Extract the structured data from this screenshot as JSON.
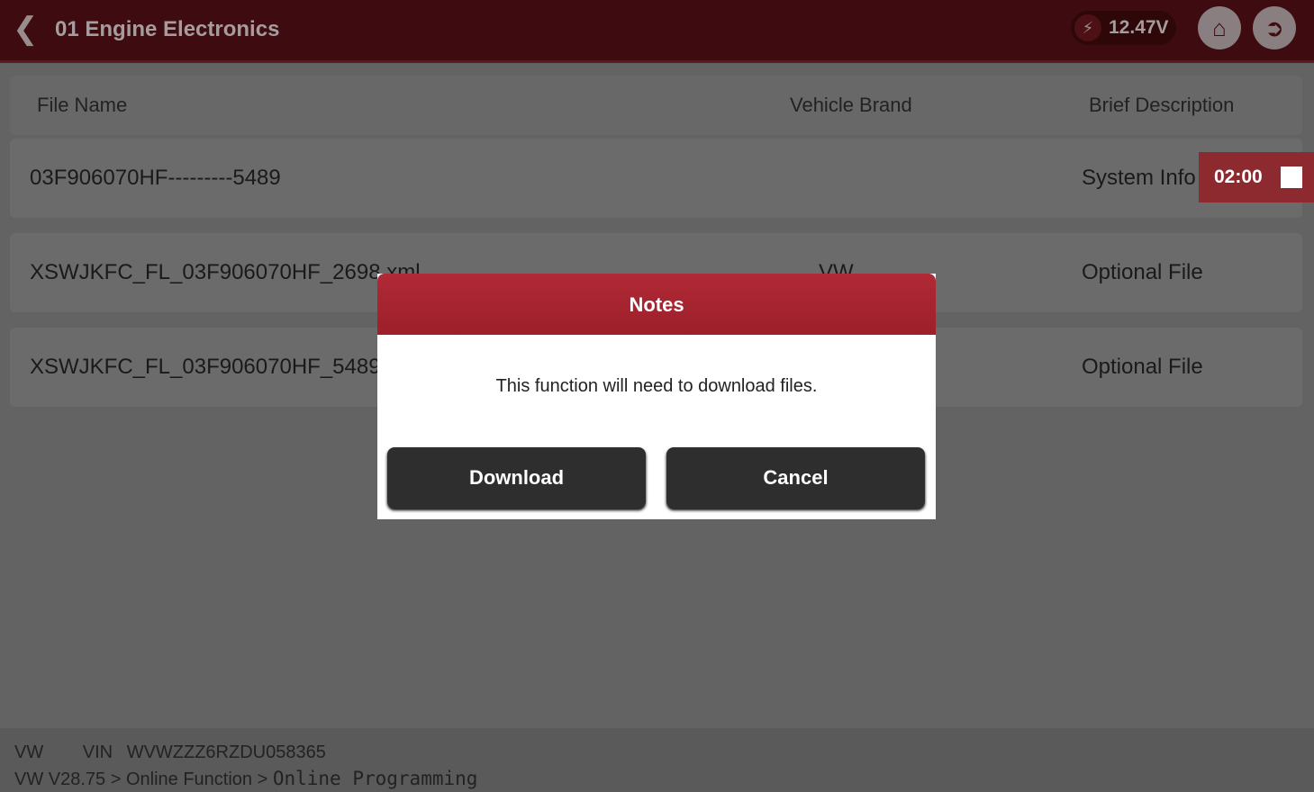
{
  "header": {
    "title": "01 Engine Electronics",
    "voltage": "12.47V",
    "icons": [
      "back-icon",
      "bolt-icon",
      "home-icon",
      "exit-icon"
    ]
  },
  "table": {
    "columns": [
      "File Name",
      "Vehicle Brand",
      "Brief Description"
    ],
    "rows": [
      {
        "file": "03F906070HF---------5489",
        "brand": "",
        "desc": "System Info"
      },
      {
        "file": "XSWJKFC_FL_03F906070HF_2698.xml",
        "brand": "VW",
        "desc": "Optional File"
      },
      {
        "file": "XSWJKFC_FL_03F906070HF_5489",
        "brand": "",
        "desc": "Optional File"
      }
    ]
  },
  "timer": "02:00",
  "footer": {
    "brand": "VW",
    "vin_label": "VIN",
    "vin": "WVWZZZ6RZDU058365",
    "path": "VW V28.75 > Online Function > ",
    "path_current": "Online Programming"
  },
  "dialog": {
    "title": "Notes",
    "message": "This function will need to download files.",
    "download": "Download",
    "cancel": "Cancel"
  },
  "colors": {
    "header": "#8e1c24",
    "dialog_header": "#a82531",
    "button": "#2e2e2e"
  }
}
